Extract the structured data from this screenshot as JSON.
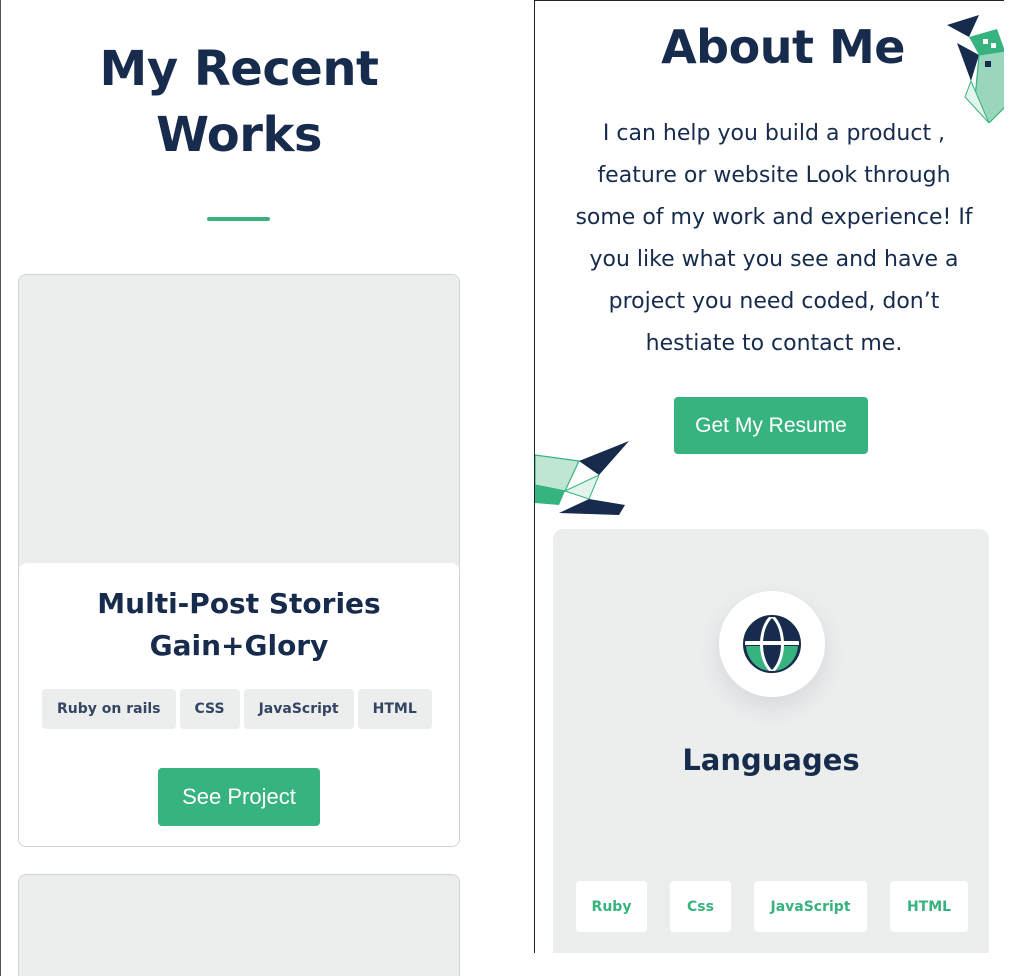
{
  "works": {
    "title_line1": "My Recent",
    "title_line2": "Works",
    "project": {
      "title_line1": "Multi-Post Stories",
      "title_line2": "Gain+Glory",
      "tags": [
        "Ruby on rails",
        "CSS",
        "JavaScript",
        "HTML"
      ],
      "button_label": "See Project"
    }
  },
  "about": {
    "title": "About Me",
    "text_lines": [
      "I can help you build a product ,",
      "feature or website Look through",
      "some of my work and experience! If",
      "you like what you see and have a",
      "project you need coded, don’t",
      "hestiate to contact me."
    ],
    "button_label": "Get My Resume"
  },
  "languages": {
    "title": "Languages",
    "icon": "globe-icon",
    "items": [
      "Ruby",
      "Css",
      "JavaScript",
      "HTML"
    ]
  },
  "colors": {
    "accent": "#36b37e",
    "navy": "#172b4d",
    "card_bg": "#ebeeed"
  }
}
